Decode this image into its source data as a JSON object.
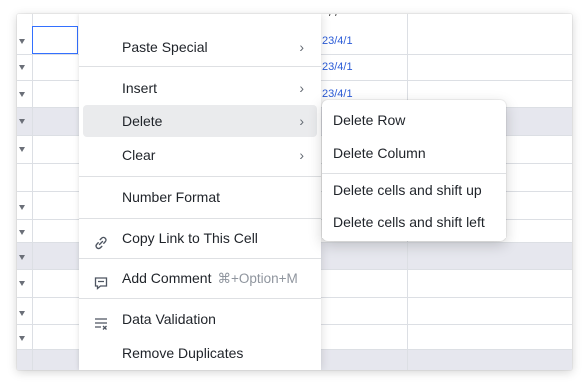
{
  "sheet": {
    "dates": [
      "23/4/1",
      "23/4/1",
      "23/4/1"
    ],
    "top_fragment": "/ /"
  },
  "menu": {
    "paste_special": "Paste Special",
    "insert": "Insert",
    "delete": "Delete",
    "clear": "Clear",
    "number_format": "Number Format",
    "copy_link": "Copy Link to This Cell",
    "add_comment": "Add Comment",
    "add_comment_shortcut": "⌘+Option+M",
    "data_validation": "Data Validation",
    "remove_duplicates": "Remove Duplicates",
    "chevron": "›"
  },
  "submenu": {
    "delete_row": "Delete Row",
    "delete_column": "Delete Column",
    "shift_up": "Delete cells and shift up",
    "shift_left": "Delete cells and shift left"
  },
  "icons": {
    "link": "link-icon",
    "comment": "comment-icon",
    "validation": "data-validation-icon",
    "dropdown": "dropdown-arrow-icon"
  },
  "colors": {
    "selection": "#3370ff",
    "date_text": "#2a5bd7",
    "hover": "#eaebed",
    "band": "#e6e7ee"
  }
}
